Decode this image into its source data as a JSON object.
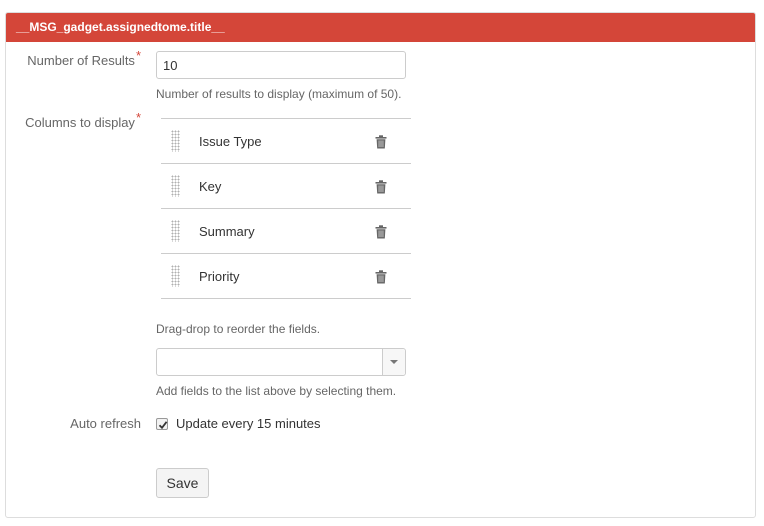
{
  "gadget": {
    "title": "__MSG_gadget.assignedtome.title__",
    "header_color": "#d44639"
  },
  "form": {
    "number_of_results": {
      "label": "Number of Results",
      "required_marker": "*",
      "value": "10",
      "help": "Number of results to display (maximum of 50)."
    },
    "columns": {
      "label": "Columns to display",
      "required_marker": "*",
      "items": [
        {
          "label": "Issue Type",
          "icon": "trash-icon"
        },
        {
          "label": "Key",
          "icon": "trash-icon"
        },
        {
          "label": "Summary",
          "icon": "trash-icon"
        },
        {
          "label": "Priority",
          "icon": "trash-icon"
        }
      ],
      "reorder_help": "Drag-drop to reorder the fields.",
      "add_select_value": "",
      "add_help": "Add fields to the list above by selecting them."
    },
    "auto_refresh": {
      "label": "Auto refresh",
      "checkbox_label": "Update every 15 minutes",
      "checked": true
    },
    "save_label": "Save"
  }
}
